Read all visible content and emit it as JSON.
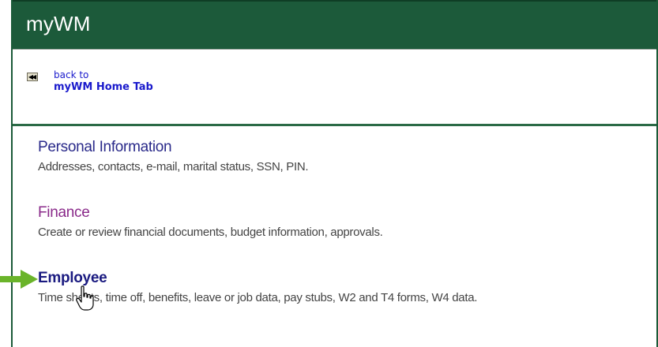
{
  "header": {
    "title": "myWM"
  },
  "back": {
    "icon": "rewind-icon",
    "line1": "back to",
    "line2": "myWM Home Tab"
  },
  "menu": {
    "items": [
      {
        "title": "Personal Information",
        "description": "Addresses, contacts, e-mail, marital status, SSN, PIN."
      },
      {
        "title": "Finance",
        "description": "Create or review financial documents, budget information, approvals."
      },
      {
        "title": "Employee",
        "description": "Time sheets, time off, benefits, leave or job data, pay stubs, W2 and T4 forms, W4 data."
      }
    ]
  },
  "colors": {
    "header_bg": "#1c5a3a",
    "link": "#1a1acc",
    "arrow": "#6ab42a"
  },
  "annotations": {
    "pointer_arrow": "green-arrow-icon",
    "cursor": "hand-pointer-icon"
  }
}
